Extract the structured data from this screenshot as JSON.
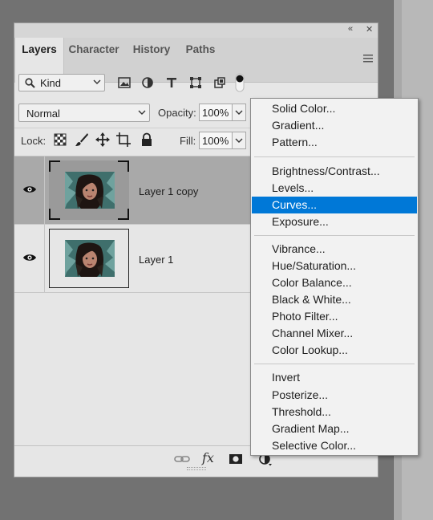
{
  "panel": {
    "collapse_glyph": "«",
    "close_glyph": "✕",
    "tabs": [
      {
        "label": "Layers"
      },
      {
        "label": "Character"
      },
      {
        "label": "History"
      },
      {
        "label": "Paths"
      }
    ],
    "filter": {
      "kind_label": "Kind",
      "icons": [
        "image-filter-icon",
        "adjustment-filter-icon",
        "type-filter-icon",
        "shape-filter-icon",
        "smart-object-filter-icon",
        "filter-toggle-icon"
      ]
    },
    "blend_mode": "Normal",
    "opacity_label": "Opacity:",
    "opacity_value": "100%",
    "lock_label": "Lock:",
    "fill_label": "Fill:",
    "fill_value": "100%",
    "layers": [
      {
        "name": "Layer 1 copy",
        "selected": true,
        "visible": true
      },
      {
        "name": "Layer 1",
        "selected": false,
        "visible": true
      }
    ],
    "bottom_fx_label": "fx"
  },
  "menu": {
    "groups": [
      [
        "Solid Color...",
        "Gradient...",
        "Pattern..."
      ],
      [
        "Brightness/Contrast...",
        "Levels...",
        "Curves...",
        "Exposure..."
      ],
      [
        "Vibrance...",
        "Hue/Saturation...",
        "Color Balance...",
        "Black & White...",
        "Photo Filter...",
        "Channel Mixer...",
        "Color Lookup..."
      ],
      [
        "Invert",
        "Posterize...",
        "Threshold...",
        "Gradient Map...",
        "Selective Color..."
      ]
    ],
    "highlighted": "Curves...",
    "highlight_color": "#0078d7"
  }
}
